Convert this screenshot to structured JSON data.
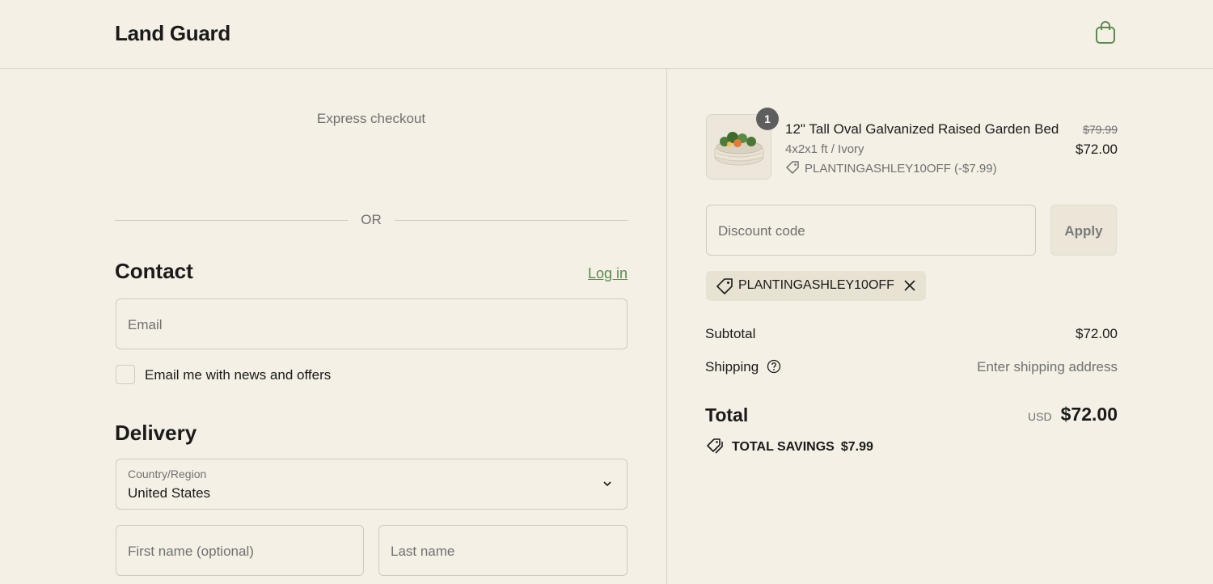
{
  "header": {
    "brand": "Land Guard",
    "cart_icon": "shopping-bag-icon"
  },
  "express": {
    "label": "Express checkout",
    "or": "OR"
  },
  "contact": {
    "title": "Contact",
    "login": "Log in",
    "email_placeholder": "Email",
    "newsletter_label": "Email me with news and offers"
  },
  "delivery": {
    "title": "Delivery",
    "country_label": "Country/Region",
    "country_value": "United States",
    "first_name_placeholder": "First name (optional)",
    "last_name_placeholder": "Last name"
  },
  "order": {
    "item": {
      "quantity": "1",
      "name": "12\" Tall Oval Galvanized Raised Garden Bed",
      "variant": "4x2x1 ft / Ivory",
      "discount": "PLANTINGASHLEY10OFF (-$7.99)",
      "price_original": "$79.99",
      "price": "$72.00"
    },
    "discount_placeholder": "Discount code",
    "apply": "Apply",
    "applied_code": "PLANTINGASHLEY10OFF",
    "subtotal_label": "Subtotal",
    "subtotal": "$72.00",
    "shipping_label": "Shipping",
    "shipping": "Enter shipping address",
    "total_label": "Total",
    "currency": "USD",
    "total": "$72.00",
    "savings_label": "TOTAL SAVINGS",
    "savings": "$7.99"
  },
  "colors": {
    "accent": "#5a8a4e",
    "background": "#f4f0e5"
  }
}
